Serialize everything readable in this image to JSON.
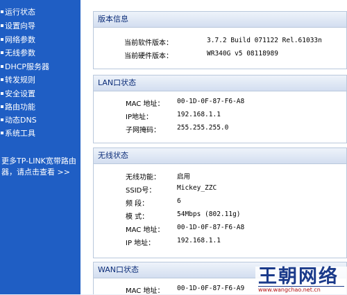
{
  "sidebar": {
    "items": [
      {
        "label": "运行状态"
      },
      {
        "label": "设置向导"
      },
      {
        "label": "网络参数"
      },
      {
        "label": "无线参数"
      },
      {
        "label": "DHCP服务器"
      },
      {
        "label": "转发规则"
      },
      {
        "label": "安全设置"
      },
      {
        "label": "路由功能"
      },
      {
        "label": "动态DNS"
      },
      {
        "label": "系统工具"
      }
    ],
    "promo": {
      "line1": "更多TP-LINK宽带路由",
      "line2": "器，请点击查看 >>"
    }
  },
  "panels": {
    "version": {
      "title": "版本信息",
      "rows": [
        {
          "label": "当前软件版本：",
          "value": "3.7.2 Build 071122 Rel.61033n"
        },
        {
          "label": "当前硬件版本：",
          "value": "WR340G v5 08118989"
        }
      ]
    },
    "lan": {
      "title": "LAN口状态",
      "rows": [
        {
          "label": "MAC 地址：",
          "value": "00-1D-0F-87-F6-A8"
        },
        {
          "label": "IP地址：",
          "value": "192.168.1.1"
        },
        {
          "label": "子网掩码：",
          "value": "255.255.255.0"
        }
      ]
    },
    "wireless": {
      "title": "无线状态",
      "rows": [
        {
          "label": "无线功能：",
          "value": "启用"
        },
        {
          "label": "SSID号：",
          "value": "Mickey_ZZC"
        },
        {
          "label": "频 段：",
          "value": "6"
        },
        {
          "label": "模 式：",
          "value": "54Mbps (802.11g)"
        },
        {
          "label": "MAC 地址：",
          "value": "00-1D-0F-87-F6-A8"
        },
        {
          "label": "IP 地址：",
          "value": "192.168.1.1"
        }
      ]
    },
    "wan": {
      "title": "WAN口状态",
      "rows": [
        {
          "label": "MAC 地址：",
          "value": "00-1D-0F-87-F6-A9"
        }
      ]
    }
  },
  "watermark": {
    "title": "王朝网络",
    "url": "www.wangchao.net.cn"
  },
  "colors": {
    "sidebar": "#1f5ec4",
    "header_text": "#0b2c78",
    "watermark": "#1a3a8a",
    "watermark_url": "#b01010"
  }
}
